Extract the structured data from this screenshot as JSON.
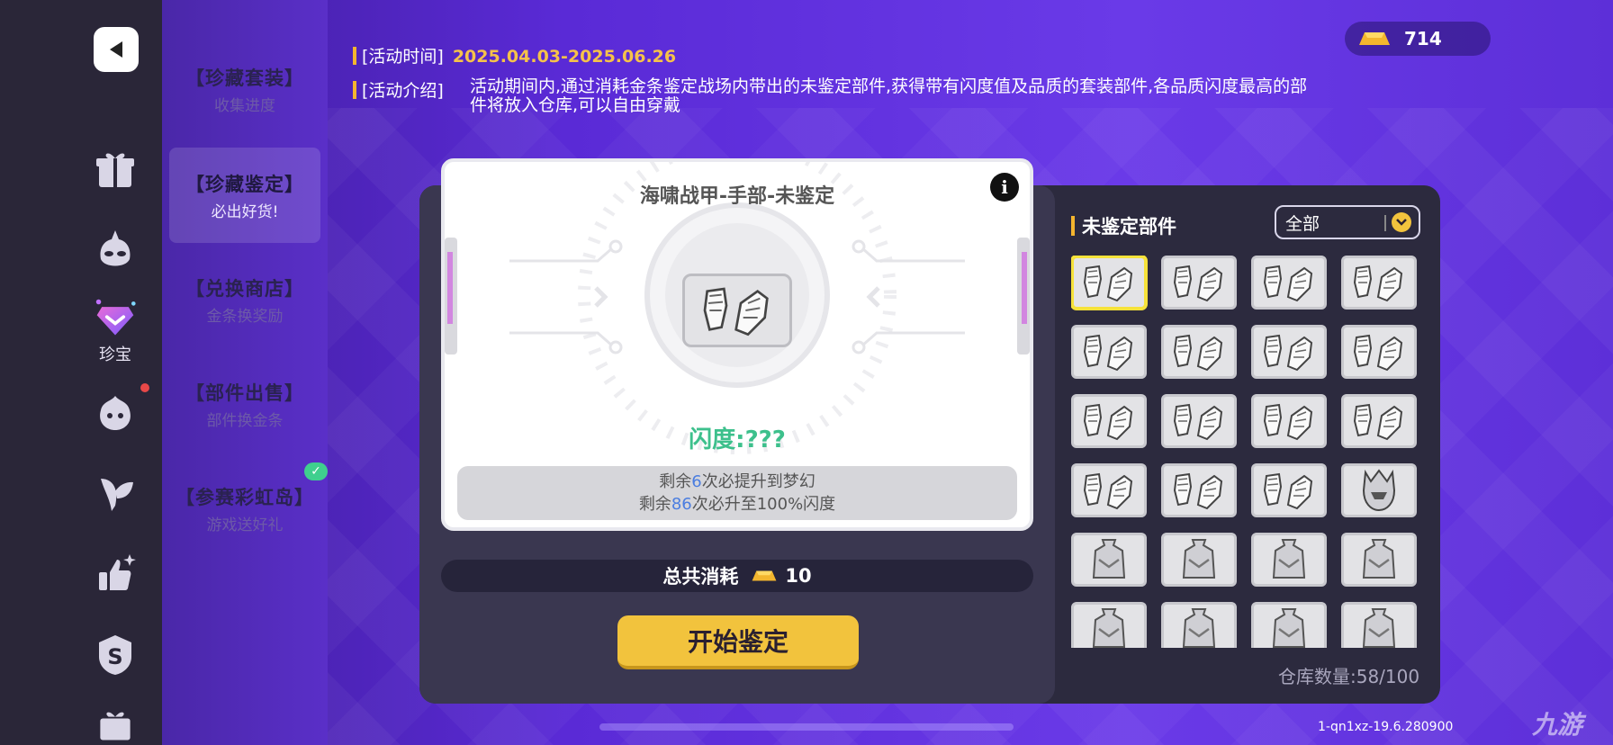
{
  "header": {
    "activity_time_label": "[活动时间]",
    "activity_time_value": "2025.04.03-2025.06.26",
    "activity_intro_label": "[活动介绍]",
    "activity_intro_value": "活动期间内,通过消耗金条鉴定战场内带出的未鉴定部件,获得带有闪度值及品质的套装部件,各品质闪度最高的部件将放入仓库,可以自由穿戴"
  },
  "currency": {
    "icon": "gold-bar-icon",
    "count": "714"
  },
  "rail": {
    "items": [
      {
        "name": "back",
        "icon": "back-arrow-icon"
      },
      {
        "name": "gift",
        "icon": "gift-icon"
      },
      {
        "name": "mask",
        "icon": "mask-icon"
      },
      {
        "name": "treasure",
        "icon": "diamond-icon",
        "label": "珍宝"
      },
      {
        "name": "pet",
        "icon": "pet-icon"
      },
      {
        "name": "leaf",
        "icon": "leaf-icon"
      },
      {
        "name": "like",
        "icon": "thumbs-up-icon"
      },
      {
        "name": "shop",
        "icon": "s-shield-icon"
      },
      {
        "name": "more",
        "icon": "gift-partial-icon"
      }
    ]
  },
  "menu": {
    "items": [
      {
        "title": "【珍藏套装】",
        "sub": "收集进度"
      },
      {
        "title": "【珍藏鉴定】",
        "sub": "必出好货!"
      },
      {
        "title": "【兑换商店】",
        "sub": "金条换奖励"
      },
      {
        "title": "【部件出售】",
        "sub": "部件换金条"
      },
      {
        "title": "【参赛彩虹岛】",
        "sub": "游戏送好礼"
      }
    ]
  },
  "identify": {
    "item_title": "海啸战甲-手部-未鉴定",
    "flash_label": "闪度:???",
    "remain_line1_pre": "剩余",
    "remain_line1_num": "6",
    "remain_line1_post": "次必提升到梦幻",
    "remain_line2_pre": "剩余",
    "remain_line2_num": "86",
    "remain_line2_post": "次必升至100%闪度",
    "total_cost_label": "总共消耗",
    "total_cost_value": "10",
    "start_button": "开始鉴定"
  },
  "inventory": {
    "title": "未鉴定部件",
    "filter_value": "全部",
    "storage_label": "仓库数量:58/100",
    "cells": [
      "gauntlet-icon",
      "gauntlet-icon",
      "gauntlet-icon",
      "gauntlet-icon",
      "gauntlet-icon",
      "gauntlet-icon",
      "gauntlet-icon",
      "gauntlet-icon",
      "gauntlet-icon",
      "gauntlet-icon",
      "gauntlet-icon",
      "gauntlet-icon",
      "gauntlet-icon",
      "gauntlet-icon",
      "gauntlet-icon",
      "helmet-icon",
      "armor-vest-icon",
      "armor-vest-icon",
      "armor-vest-icon",
      "armor-vest-icon",
      "armor-vest-icon",
      "armor-vest-icon",
      "armor-vest-icon",
      "armor-vest-icon"
    ]
  },
  "footer": {
    "version": "1-qn1xz-19.6.280900",
    "watermark": "九游"
  },
  "colors": {
    "accent": "#f2c33d",
    "flash": "#3dc08c",
    "highlight": "#4a7de0",
    "selected": "#f6e23a"
  }
}
